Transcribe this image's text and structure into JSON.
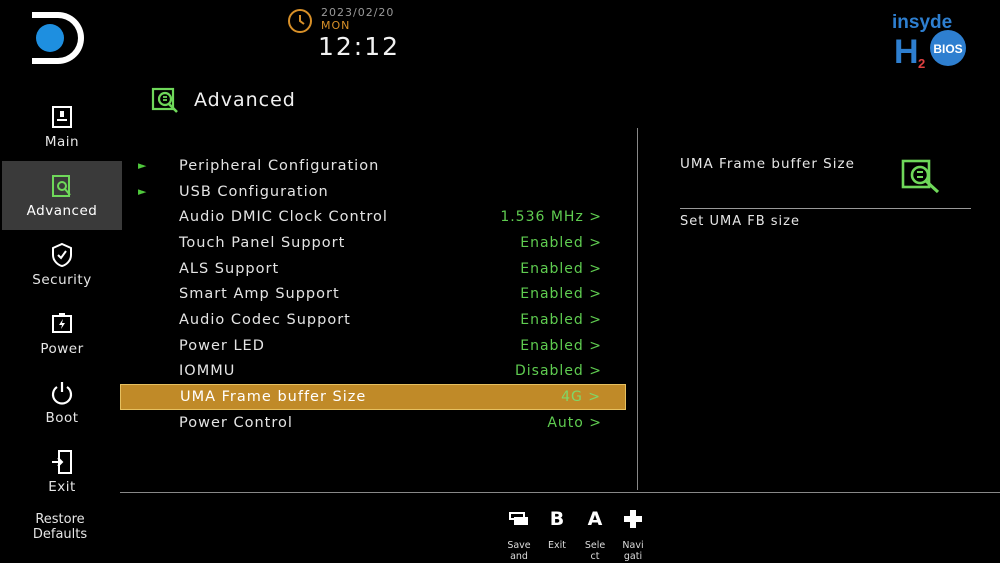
{
  "header": {
    "date": "2023/02/20",
    "day": "MON",
    "time": "12:12",
    "brand_line1": "insyde",
    "brand_line2": "BIOS"
  },
  "sidebar": {
    "items": [
      {
        "label": "Main",
        "icon": "main-icon",
        "active": false
      },
      {
        "label": "Advanced",
        "icon": "advanced-icon",
        "active": true
      },
      {
        "label": "Security",
        "icon": "shield-icon",
        "active": false
      },
      {
        "label": "Power",
        "icon": "battery-icon",
        "active": false
      },
      {
        "label": "Boot",
        "icon": "power-icon",
        "active": false
      },
      {
        "label": "Exit",
        "icon": "exit-door-icon",
        "active": false
      }
    ],
    "restore_line1": "Restore",
    "restore_line2": "Defaults"
  },
  "page": {
    "title": "Advanced"
  },
  "menu": {
    "items": [
      {
        "label": "Peripheral Configuration",
        "value": "",
        "submenu": true
      },
      {
        "label": "USB Configuration",
        "value": "",
        "submenu": true
      },
      {
        "label": "Audio DMIC Clock Control",
        "value": "1.536 MHz >"
      },
      {
        "label": "Touch Panel Support",
        "value": "Enabled >"
      },
      {
        "label": "ALS Support",
        "value": "Enabled >"
      },
      {
        "label": "Smart Amp Support",
        "value": "Enabled >"
      },
      {
        "label": "Audio Codec Support",
        "value": "Enabled >"
      },
      {
        "label": "Power LED",
        "value": "Enabled >"
      },
      {
        "label": "IOMMU",
        "value": "Disabled >"
      },
      {
        "label": "UMA Frame buffer Size",
        "value": "4G >",
        "selected": true
      },
      {
        "label": "Power Control",
        "value": "Auto >"
      }
    ]
  },
  "help": {
    "title": "UMA Frame buffer Size",
    "description": "Set UMA FB size"
  },
  "keys": [
    {
      "glyph_icon": "save-icon",
      "label": "Save and"
    },
    {
      "glyph": "B",
      "label": "Exit"
    },
    {
      "glyph": "A",
      "label": "Sele ct"
    },
    {
      "glyph_icon": "dpad-icon",
      "label": "Navi gati"
    }
  ],
  "colors": {
    "accent_green": "#5fcc50",
    "selected_row": "#c08a28",
    "clock_orange": "#d89028",
    "logo_blue": "#1e8fe0"
  }
}
